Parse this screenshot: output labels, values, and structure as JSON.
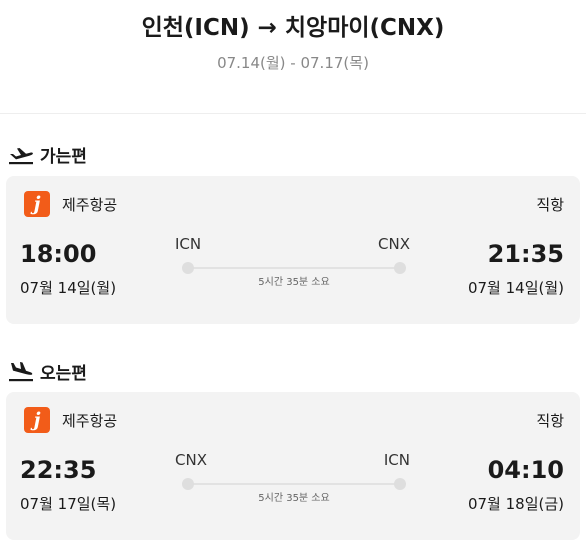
{
  "header": {
    "route": "인천(ICN) → 치앙마이(CNX)",
    "dates": "07.14(월) - 07.17(목)"
  },
  "outbound": {
    "label": "가는편",
    "icon": "plane-takeoff-icon",
    "airline": {
      "name": "제주항공",
      "logo_letter": "j",
      "logo_color": "#f25c19"
    },
    "type": "직항",
    "departure": {
      "time": "18:00",
      "date": "07월 14일(월)",
      "code": "ICN"
    },
    "arrival": {
      "time": "21:35",
      "date": "07월 14일(월)",
      "code": "CNX"
    },
    "duration": "5시간 35분 소요"
  },
  "inbound": {
    "label": "오는편",
    "icon": "plane-landing-icon",
    "airline": {
      "name": "제주항공",
      "logo_letter": "j",
      "logo_color": "#f25c19"
    },
    "type": "직항",
    "departure": {
      "time": "22:35",
      "date": "07월 17일(목)",
      "code": "CNX"
    },
    "arrival": {
      "time": "04:10",
      "date": "07월 18일(금)",
      "code": "ICN"
    },
    "duration": "5시간 35분 소요"
  }
}
